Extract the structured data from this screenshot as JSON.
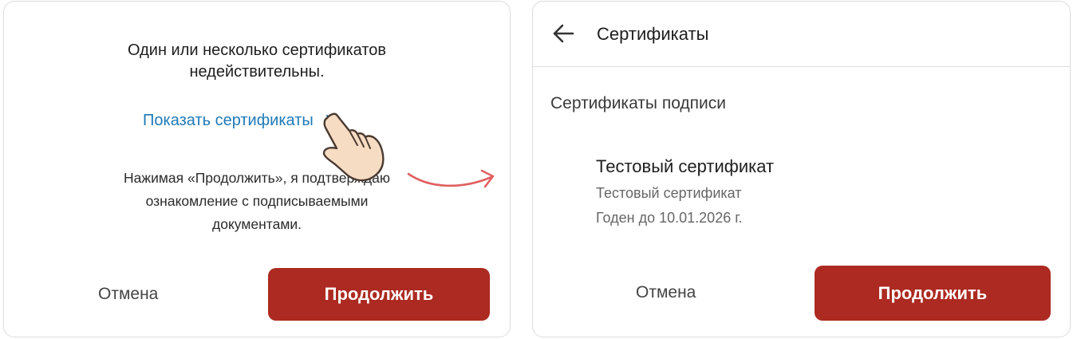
{
  "left_dialog": {
    "warning_line1": "Один или несколько сертификатов",
    "warning_line2": "недействительны.",
    "show_certs_link": "Показать сертификаты",
    "consent_line1": "Нажимая «Продолжить», я подтверждаю",
    "consent_line2": "ознакомление с подписываемыми",
    "consent_line3": "документами.",
    "cancel_label": "Отмена",
    "continue_label": "Продолжить"
  },
  "right_screen": {
    "header_title": "Сертификаты",
    "section_title": "Сертификаты подписи",
    "certificate": {
      "name": "Тестовый сертификат",
      "subtitle": "Тестовый сертификат",
      "valid_until": "Годен до 10.01.2026 г."
    },
    "cancel_label": "Отмена",
    "continue_label": "Продолжить"
  },
  "icons": {
    "hand": "hand-pointer-icon",
    "arrow": "curved-arrow-icon",
    "back": "back-arrow-icon",
    "chevron": "chevron-right-icon"
  },
  "colors": {
    "accent": "#ac2a21",
    "link": "#1f7ab8",
    "pointer_arrow": "#e06060"
  }
}
